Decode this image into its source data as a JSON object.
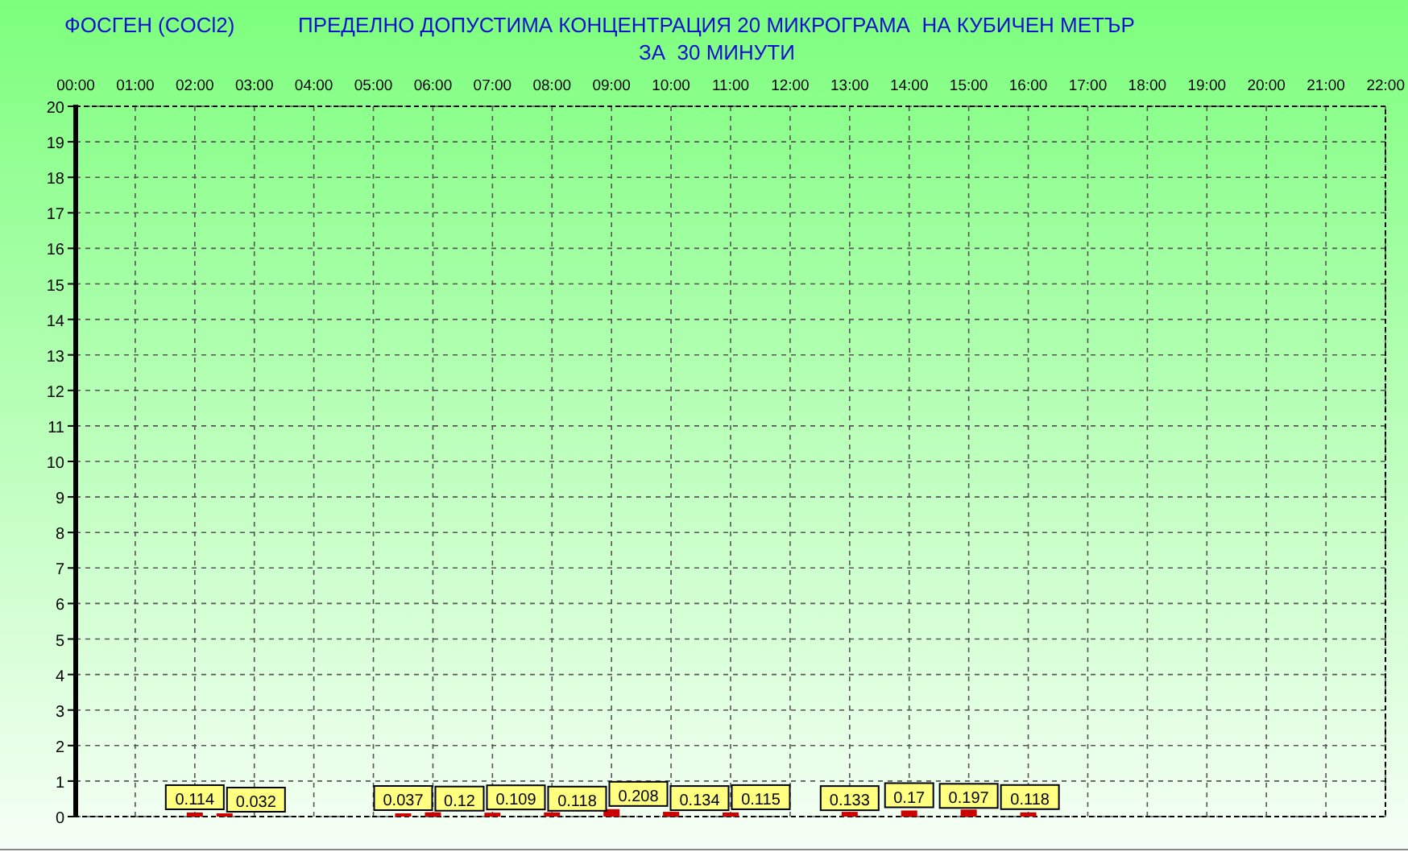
{
  "header": {
    "parts": [
      "ФОСГЕН",
      "(COCl2)",
      "ПРЕДЕЛНО ДОПУСТИМА КОНЦЕНТРАЦИЯ 20 МИКРОГРАМА  НА КУБИЧЕН МЕТЪР"
    ],
    "subtitle": "ЗА  30 МИНУТИ"
  },
  "chart_data": {
    "type": "bar",
    "x": [
      2,
      2.5,
      5.5,
      6,
      7,
      8,
      9,
      10,
      11,
      13,
      14,
      15,
      16
    ],
    "grid": true,
    "series": [
      {
        "color": "#cc0000",
        "values": [
          0.114,
          0.032,
          0.037,
          0.12,
          0.109,
          0.118,
          0.208,
          0.134,
          0.115,
          0.133,
          0.17,
          0.197,
          0.118
        ]
      }
    ],
    "value_labels": [
      "0.114",
      "0.032",
      "0.037",
      "0.12",
      "0.109",
      "0.118",
      "0.208",
      "0.134",
      "0.115",
      "0.133",
      "0.17",
      "0.197",
      "0.118"
    ],
    "xlim": [
      0,
      22
    ],
    "ylim": [
      0,
      20
    ],
    "xticks": [
      {
        "value": 0,
        "label": "00:00"
      },
      {
        "value": 1,
        "label": "01:00"
      },
      {
        "value": 2,
        "label": "02:00"
      },
      {
        "value": 3,
        "label": "03:00"
      },
      {
        "value": 4,
        "label": "04:00"
      },
      {
        "value": 5,
        "label": "05:00"
      },
      {
        "value": 6,
        "label": "06:00"
      },
      {
        "value": 7,
        "label": "07:00"
      },
      {
        "value": 8,
        "label": "08:00"
      },
      {
        "value": 9,
        "label": "09:00"
      },
      {
        "value": 10,
        "label": "10:00"
      },
      {
        "value": 11,
        "label": "11:00"
      },
      {
        "value": 12,
        "label": "12:00"
      },
      {
        "value": 13,
        "label": "13:00"
      },
      {
        "value": 14,
        "label": "14:00"
      },
      {
        "value": 15,
        "label": "15:00"
      },
      {
        "value": 16,
        "label": "16:00"
      },
      {
        "value": 17,
        "label": "17:00"
      },
      {
        "value": 18,
        "label": "18:00"
      },
      {
        "value": 19,
        "label": "19:00"
      },
      {
        "value": 20,
        "label": "20:00"
      },
      {
        "value": 21,
        "label": "21:00"
      },
      {
        "value": 22,
        "label": "22:00"
      }
    ],
    "yticks": [
      0,
      1,
      2,
      3,
      4,
      5,
      6,
      7,
      8,
      9,
      10,
      11,
      12,
      13,
      14,
      15,
      16,
      17,
      18,
      19,
      20
    ]
  }
}
